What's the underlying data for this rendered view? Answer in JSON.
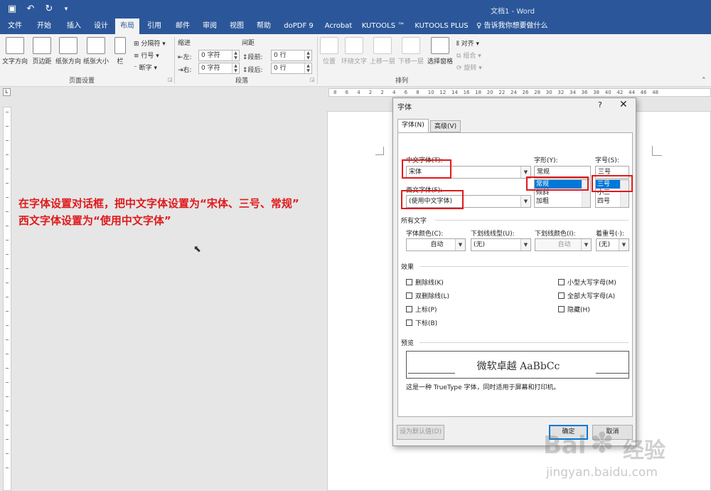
{
  "titlebar": {
    "doc_title": "文档1 - Word"
  },
  "quick_access": [
    "save-icon",
    "undo-icon",
    "redo-icon",
    "customize-icon"
  ],
  "ribbon_tabs": [
    "文件",
    "开始",
    "插入",
    "设计",
    "布局",
    "引用",
    "邮件",
    "审阅",
    "视图",
    "帮助",
    "doPDF 9",
    "Acrobat",
    "KUTOOLS ™",
    "KUTOOLS PLUS",
    "告诉我你想要做什么"
  ],
  "active_tab": "布局",
  "ribbon": {
    "page_setup": {
      "text_dir": "文字方向",
      "margins": "页边距",
      "orientation": "纸张方向",
      "size": "纸张大小",
      "columns": "栏",
      "breaks": "分隔符",
      "line_numbers": "行号",
      "hyphen": "断字",
      "label": "页面设置"
    },
    "paragraph": {
      "indent": "缩进",
      "spacing": "间距",
      "left": "左:",
      "right": "右:",
      "left_val": "0 字符",
      "right_val": "0 字符",
      "before": "段前:",
      "after": "段后:",
      "before_val": "0 行",
      "after_val": "0 行",
      "label": "段落"
    },
    "arrange": {
      "position": "位置",
      "wrap": "环绕文字",
      "forward": "上移一层",
      "backward": "下移一层",
      "pane": "选择窗格",
      "align": "对齐",
      "group": "组合",
      "rotate": "旋转",
      "label": "排列"
    }
  },
  "ruler_numbers": [
    "8",
    "6",
    "4",
    "2",
    "2",
    "4",
    "6",
    "8",
    "10",
    "12",
    "14",
    "16",
    "18",
    "20",
    "22",
    "24",
    "26",
    "28",
    "30",
    "32",
    "34",
    "36",
    "38",
    "40",
    "42",
    "44",
    "46",
    "48"
  ],
  "annotation": {
    "line1": "在字体设置对话框，把中文字体设置为“宋体、三号、常规”",
    "line2": "西文字体设置为“使用中文字体”"
  },
  "dialog": {
    "title": "字体",
    "help": "?",
    "close": "✕",
    "tabs": [
      "字体(N)",
      "高级(V)"
    ],
    "cn_font_label": "中文字体(T):",
    "cn_font_value": "宋体",
    "style_label": "字形(Y):",
    "style_value": "常规",
    "style_list": [
      "常规",
      "倾斜",
      "加粗"
    ],
    "size_label": "字号(S):",
    "size_value": "三号",
    "size_list": [
      "三号",
      "小三",
      "四号"
    ],
    "west_font_label": "西文字体(F):",
    "west_font_value": "(使用中文字体)",
    "all_text": "所有文字",
    "font_color_label": "字体颜色(C):",
    "font_color_value": "自动",
    "underline_label": "下划线线型(U):",
    "underline_value": "(无)",
    "underline_color_label": "下划线颜色(I):",
    "underline_color_value": "自动",
    "emphasis_label": "着重号(·):",
    "emphasis_value": "(无)",
    "effects": "效果",
    "checks_left": [
      "删除线(K)",
      "双删除线(L)",
      "上标(P)",
      "下标(B)"
    ],
    "checks_right": [
      "小型大写字母(M)",
      "全部大写字母(A)",
      "隐藏(H)"
    ],
    "preview_label": "预览",
    "preview_text": "微软卓越  AaBbCc",
    "preview_note": "这是一种 TrueType 字体，同时适用于屏幕和打印机。",
    "set_default": "设为默认值(D)",
    "ok": "确定",
    "cancel": "取消"
  },
  "watermark": {
    "brand": "Bai",
    "brand2": "经验",
    "url": "jingyan.baidu.com"
  },
  "colors": {
    "word_blue": "#2b579a",
    "annotation_red": "#e0191b",
    "select_blue": "#0078d7"
  }
}
